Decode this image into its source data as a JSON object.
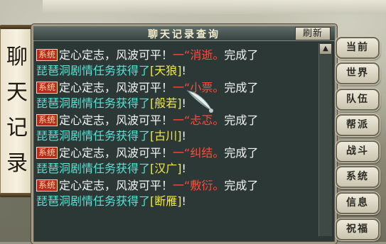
{
  "dialog": {
    "title": "聊天记录查询",
    "refresh_label": "刷新"
  },
  "side_tab": {
    "chars": [
      "聊",
      "天",
      "记",
      "录"
    ]
  },
  "messages": [
    {
      "tag": "系统",
      "intro": "定心定志，风波可平！",
      "dash": "一“",
      "riddle": "消逝",
      "period": "。",
      "done": "完成了",
      "task": "琵琶洞剧情任务获得了",
      "reward": "[天狼]",
      "end": "!"
    },
    {
      "tag": "系统",
      "intro": "定心定志，风波可平！",
      "dash": "一“",
      "riddle": "小票",
      "period": "。",
      "done": "完成了",
      "task": "琵琶洞剧情任务获得了",
      "reward": "[般若]",
      "end": "!"
    },
    {
      "tag": "系统",
      "intro": "定心定志，风波可平！",
      "dash": "一“",
      "riddle": "忐忑",
      "period": "。",
      "done": "完成了",
      "task": "琵琶洞剧情任务获得了",
      "reward": "[古川]",
      "end": "!"
    },
    {
      "tag": "系统",
      "intro": "定心定志，风波可平！",
      "dash": "一“",
      "riddle": "纠结",
      "period": "。",
      "done": "完成了",
      "task": "琵琶洞剧情任务获得了",
      "reward": "[汉广]",
      "end": "!"
    },
    {
      "tag": "系统",
      "intro": "定心定志，风波可平！",
      "dash": "一“",
      "riddle": "敷衍",
      "period": "。",
      "done": "完成了",
      "task": "琵琶洞剧情任务获得了",
      "reward": "[断雁]",
      "end": "!"
    }
  ],
  "channels": [
    "当前",
    "世界",
    "队伍",
    "帮派",
    "战斗",
    "系统",
    "信息",
    "祝福"
  ],
  "icons": {
    "scroll_up": "chevron-up-icon",
    "cursor": "feather-cursor-icon"
  },
  "colors": {
    "tag_bg": "#b52a1c",
    "msg_white": "#f4f4f4",
    "riddle_red": "#ff4b3b",
    "task_cyan": "#53e5d6",
    "reward_yellow": "#f2ea3e"
  }
}
